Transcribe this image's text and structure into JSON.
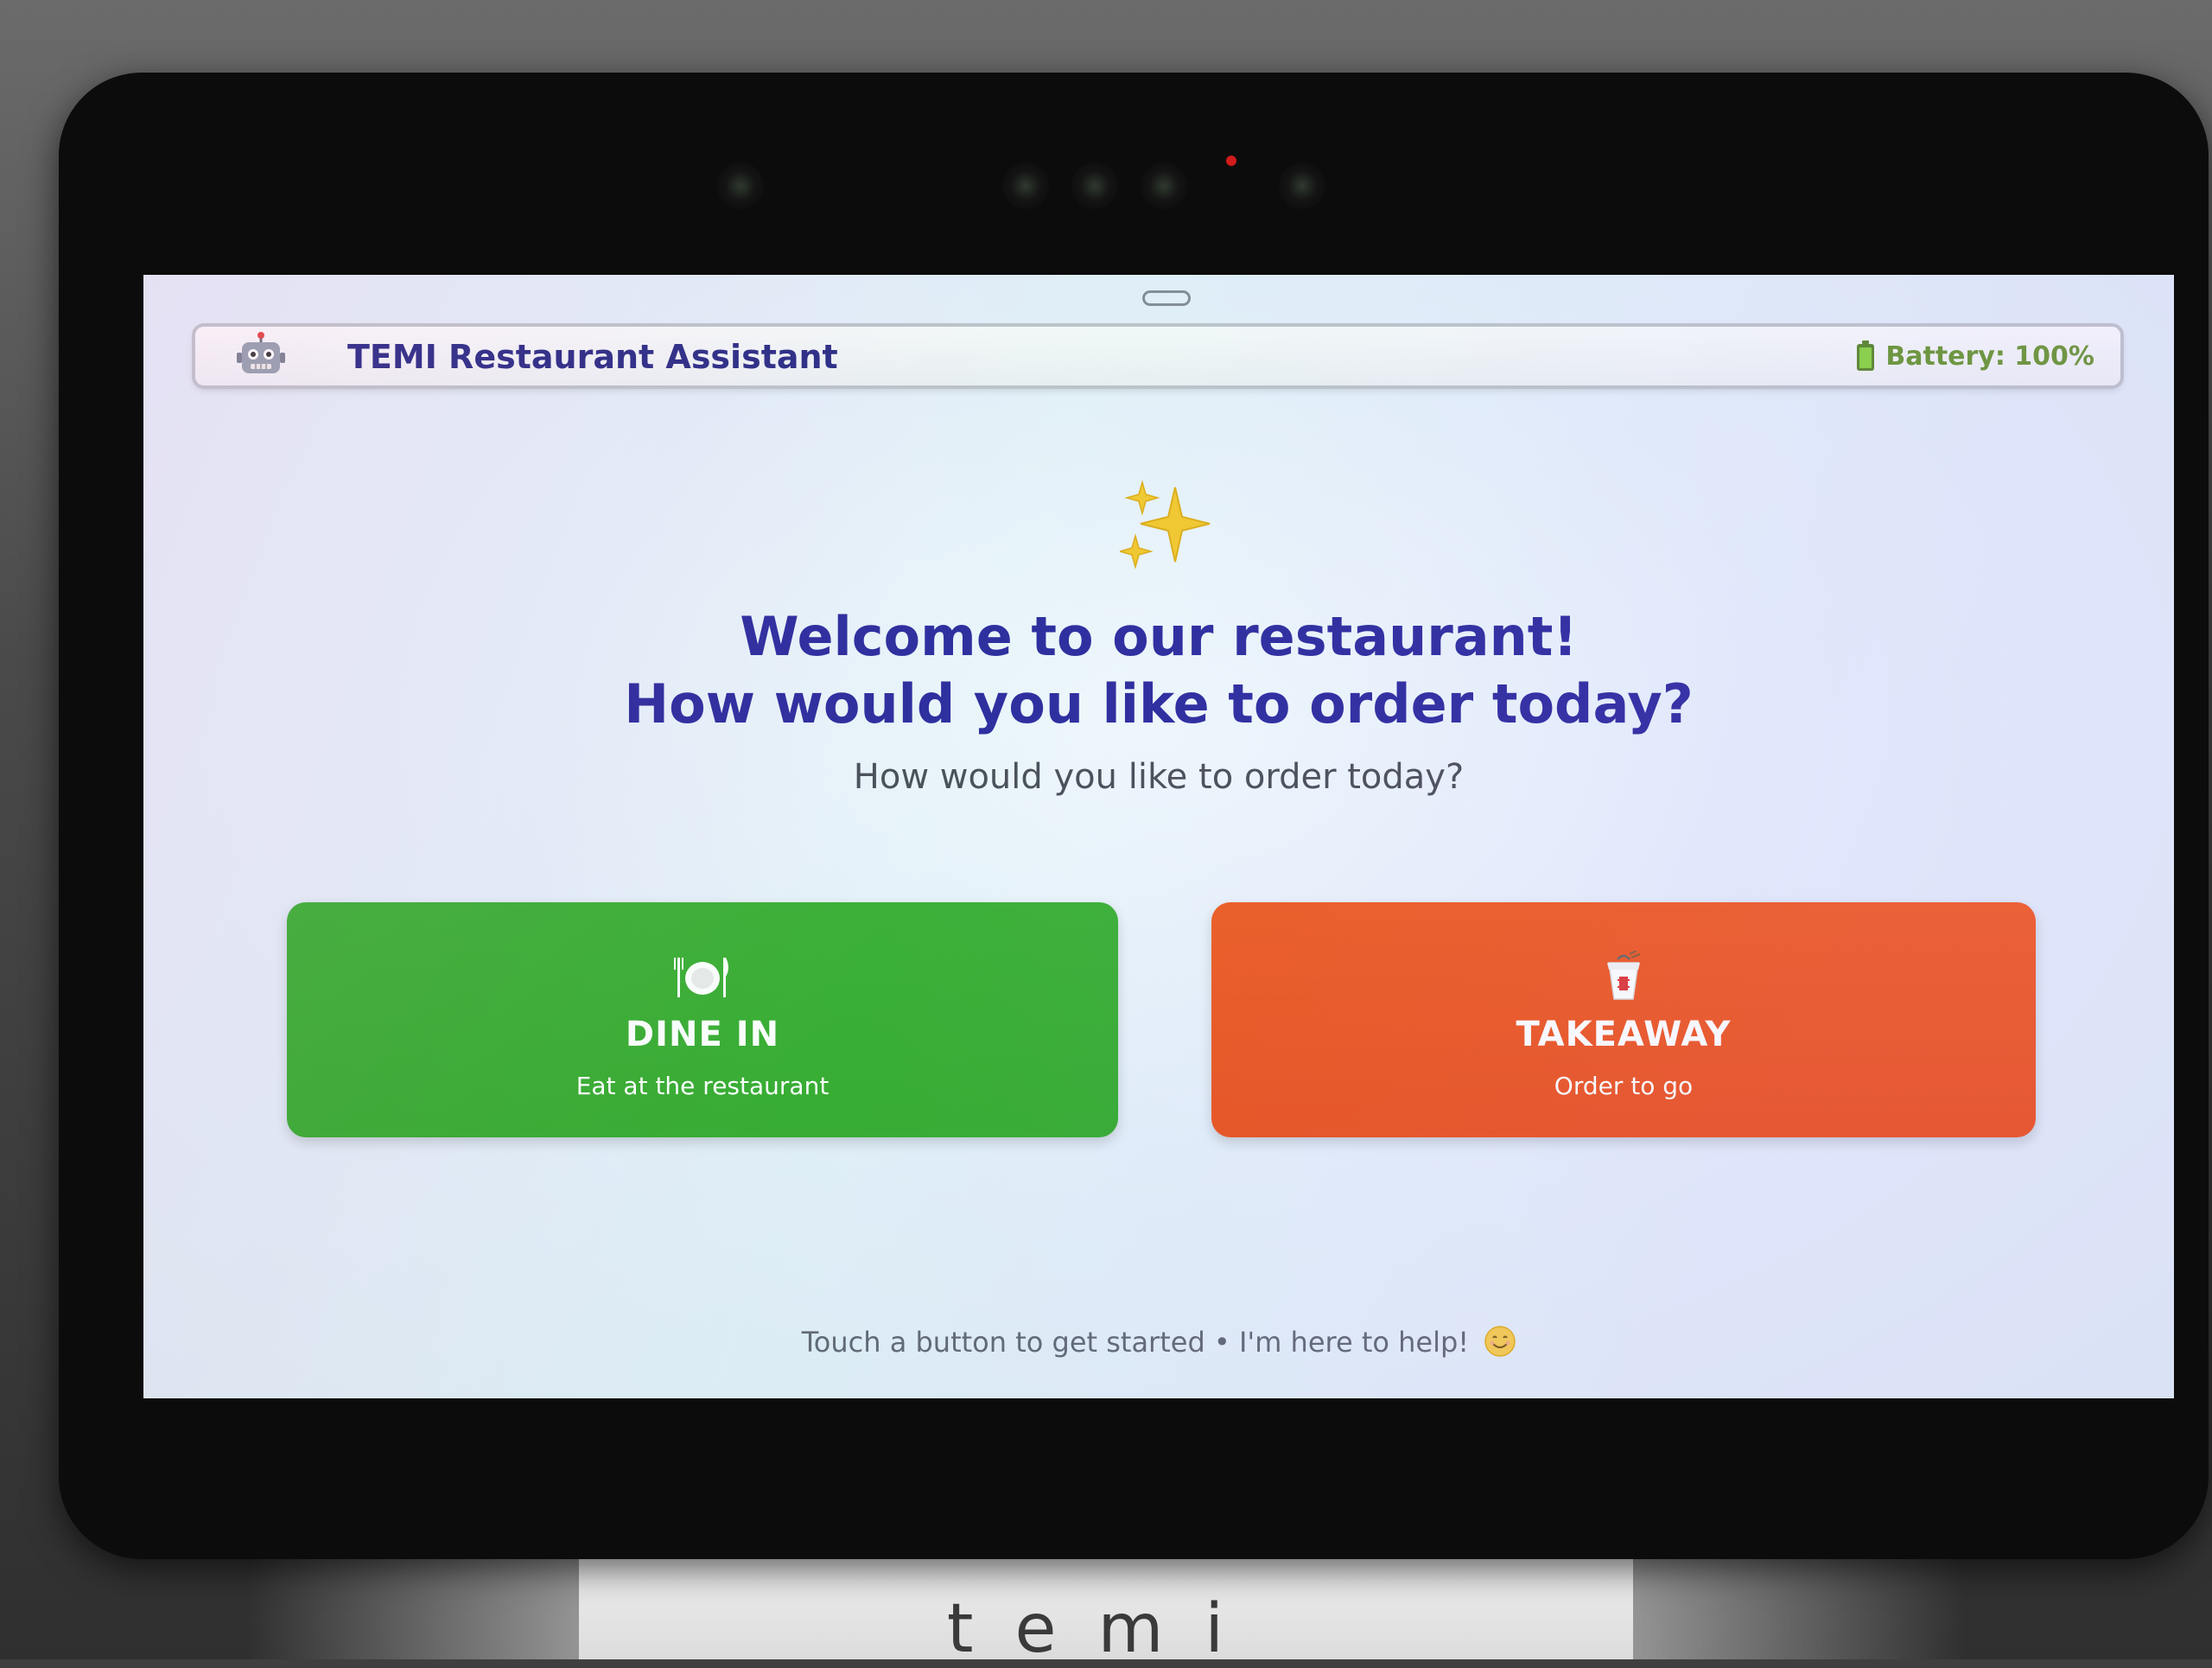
{
  "device": {
    "brand": "temi"
  },
  "header": {
    "robot_icon": "robot-icon",
    "title": "TEMI Restaurant Assistant",
    "battery_icon": "battery-icon",
    "battery_text": "Battery: 100%"
  },
  "welcome": {
    "sparkle_icon": "sparkles-icon",
    "line1": "Welcome to our restaurant!",
    "line2": "How would you like to order today?",
    "subtitle": "How would you like to order today?"
  },
  "options": {
    "dine_in": {
      "icon": "plate-cutlery-icon",
      "label": "DINE IN",
      "description": "Eat at the restaurant",
      "color": "#2aa622"
    },
    "takeaway": {
      "icon": "takeout-box-icon",
      "label": "TAKEAWAY",
      "description": "Order to go",
      "color": "#ee450b"
    }
  },
  "footer": {
    "text": "Touch a button to get started • I'm here to help!",
    "emoji_icon": "smiling-face-icon"
  },
  "colors": {
    "title_blue": "#16157a",
    "heading_blue": "#1a1396",
    "battery_green": "#5a8a1c"
  }
}
